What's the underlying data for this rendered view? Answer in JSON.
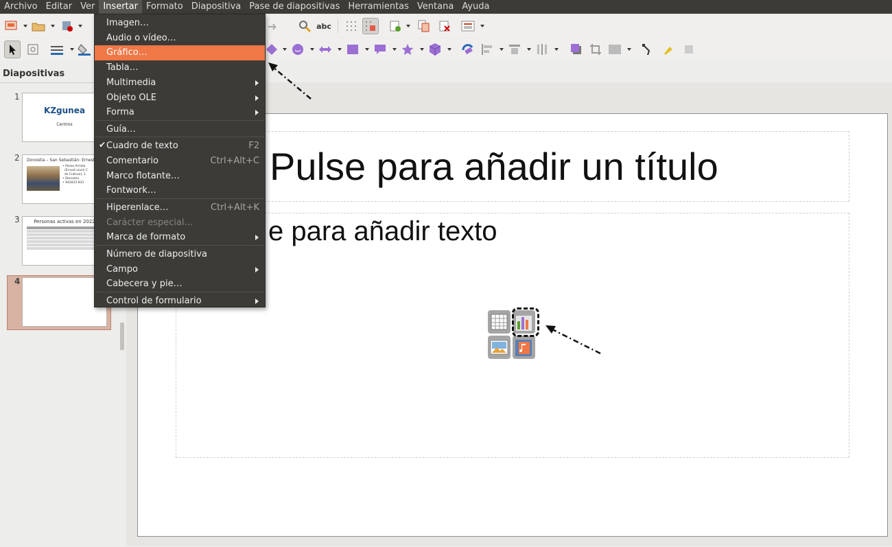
{
  "menubar": {
    "items": [
      "Archivo",
      "Editar",
      "Ver",
      "Insertar",
      "Formato",
      "Diapositiva",
      "Pase de diapositivas",
      "Herramientas",
      "Ventana",
      "Ayuda"
    ],
    "active": "Insertar"
  },
  "insert_menu": {
    "items": [
      {
        "label": "Imagen…",
        "shortcut": "",
        "submenu": false,
        "checked": false,
        "disabled": false,
        "highlighted": false
      },
      {
        "label": "Audio o vídeo…",
        "shortcut": "",
        "submenu": false,
        "checked": false,
        "disabled": false,
        "highlighted": false
      },
      {
        "label": "Gráfico…",
        "shortcut": "",
        "submenu": false,
        "checked": false,
        "disabled": false,
        "highlighted": true
      },
      {
        "label": "Tabla…",
        "shortcut": "",
        "submenu": false,
        "checked": false,
        "disabled": false,
        "highlighted": false
      },
      {
        "label": "Multimedia",
        "shortcut": "",
        "submenu": true,
        "checked": false,
        "disabled": false,
        "highlighted": false
      },
      {
        "label": "Objeto OLE",
        "shortcut": "",
        "submenu": true,
        "checked": false,
        "disabled": false,
        "highlighted": false
      },
      {
        "label": "Forma",
        "shortcut": "",
        "submenu": true,
        "checked": false,
        "disabled": false,
        "highlighted": false
      },
      {
        "label": "Guía…",
        "shortcut": "",
        "submenu": false,
        "checked": false,
        "disabled": false,
        "highlighted": false
      },
      {
        "label": "Cuadro de texto",
        "shortcut": "F2",
        "submenu": false,
        "checked": true,
        "disabled": false,
        "highlighted": false
      },
      {
        "label": "Comentario",
        "shortcut": "Ctrl+Alt+C",
        "submenu": false,
        "checked": false,
        "disabled": false,
        "highlighted": false
      },
      {
        "label": "Marco flotante…",
        "shortcut": "",
        "submenu": false,
        "checked": false,
        "disabled": false,
        "highlighted": false
      },
      {
        "label": "Fontwork…",
        "shortcut": "",
        "submenu": false,
        "checked": false,
        "disabled": false,
        "highlighted": false
      },
      {
        "label": "Hiperenlace…",
        "shortcut": "Ctrl+Alt+K",
        "submenu": false,
        "checked": false,
        "disabled": false,
        "highlighted": false
      },
      {
        "label": "Carácter especial…",
        "shortcut": "",
        "submenu": false,
        "checked": false,
        "disabled": true,
        "highlighted": false
      },
      {
        "label": "Marca de formato",
        "shortcut": "",
        "submenu": true,
        "checked": false,
        "disabled": false,
        "highlighted": false
      },
      {
        "label": "Número de diapositiva",
        "shortcut": "",
        "submenu": false,
        "checked": false,
        "disabled": false,
        "highlighted": false
      },
      {
        "label": "Campo",
        "shortcut": "",
        "submenu": true,
        "checked": false,
        "disabled": false,
        "highlighted": false
      },
      {
        "label": "Cabecera y pie…",
        "shortcut": "",
        "submenu": false,
        "checked": false,
        "disabled": false,
        "highlighted": false
      },
      {
        "label": "Control de formulario",
        "shortcut": "",
        "submenu": true,
        "checked": false,
        "disabled": false,
        "highlighted": false
      }
    ]
  },
  "slides_panel": {
    "title": "Diapositivas",
    "slides": [
      {
        "number": "1",
        "title": "KZgunea",
        "subtitle": "Centros"
      },
      {
        "number": "2",
        "title": "Donostia – San Sebastián: Ernest",
        "bullets": "• Paseo Arriola\n  (Ernest Lluch C\n  de Cultura), 1\n• Donostia\n• 943023 833"
      },
      {
        "number": "3",
        "title": "Personas activas en 2022"
      },
      {
        "number": "4",
        "selected": true
      }
    ]
  },
  "slide": {
    "title_placeholder": "Pulse para añadir un título",
    "content_placeholder": "e para añadir texto"
  },
  "colors": {
    "menu_highlight": "#f07746",
    "menu_bg": "#3c3b37",
    "thumb_title": "#1e4f86",
    "selected_slide": "#d8b2a3"
  },
  "icons": {
    "insert_placeholder": [
      "table-icon",
      "chart-icon",
      "image-icon",
      "media-icon"
    ]
  }
}
